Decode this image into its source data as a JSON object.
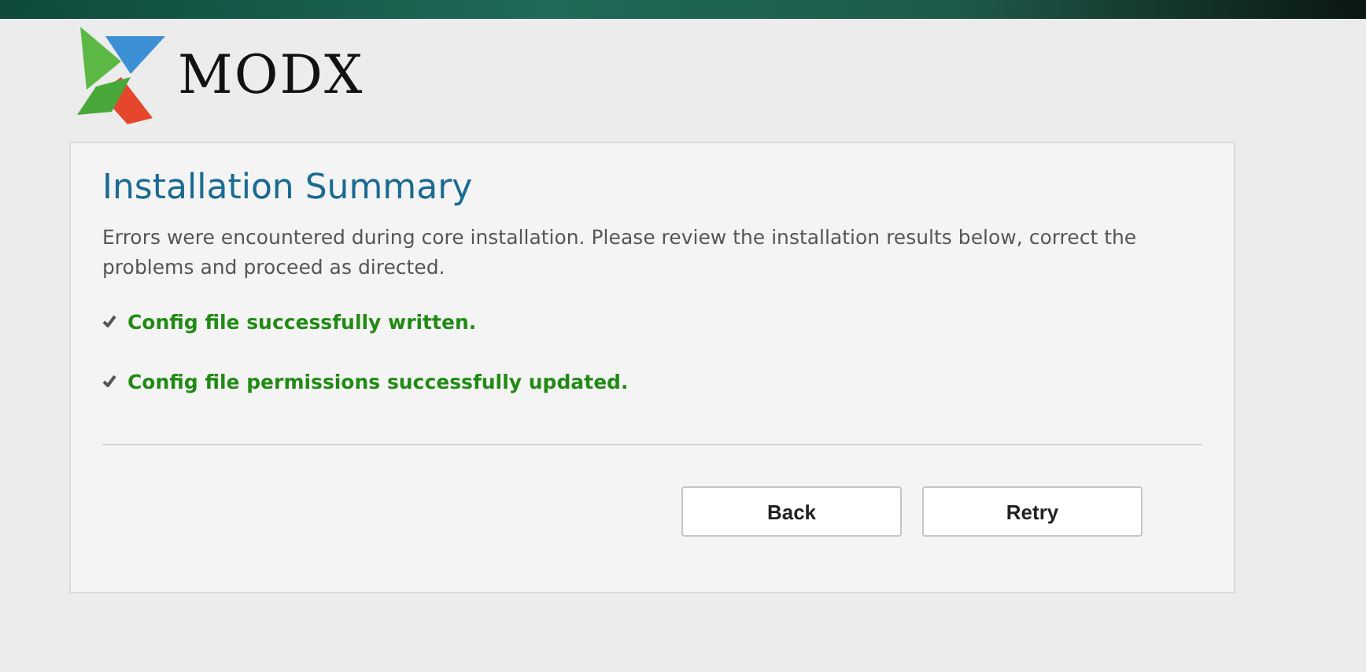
{
  "logo": {
    "text": "MODX"
  },
  "summary": {
    "title": "Installation Summary",
    "message": "Errors were encountered during core installation. Please review the installation results below, correct the problems and proceed as directed.",
    "results": [
      {
        "kind": "success",
        "text": "Config file successfully written."
      },
      {
        "kind": "success",
        "text": "Config file permissions successfully updated."
      }
    ]
  },
  "buttons": [
    {
      "label": "Back"
    },
    {
      "label": "Retry"
    }
  ]
}
